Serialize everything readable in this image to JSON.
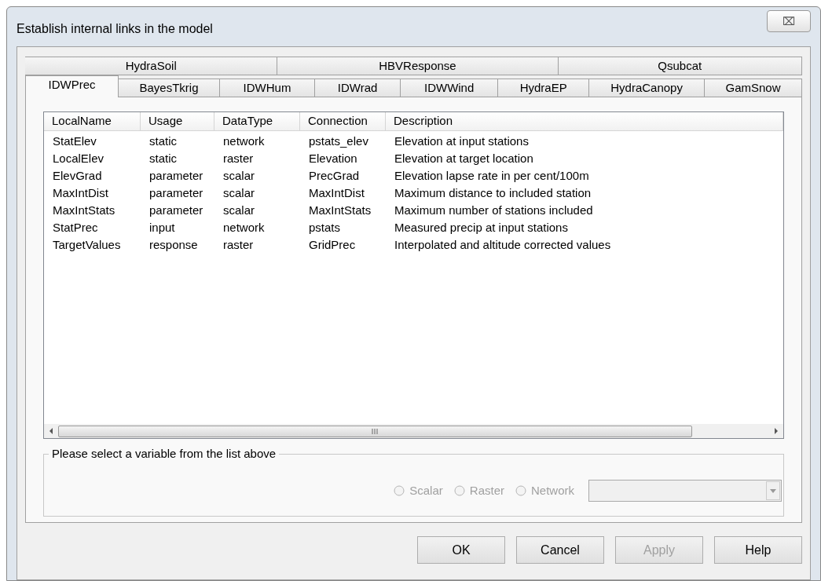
{
  "window": {
    "title": "Establish internal links in the model",
    "close_label": "⌧"
  },
  "tab_rows": [
    [
      {
        "label": "HydraSoil",
        "selected": false
      },
      {
        "label": "HBVResponse",
        "selected": false
      },
      {
        "label": "Qsubcat",
        "selected": false
      }
    ],
    [
      {
        "label": "IDWPrec",
        "selected": true
      },
      {
        "label": "BayesTkrig",
        "selected": false
      },
      {
        "label": "IDWHum",
        "selected": false
      },
      {
        "label": "IDWrad",
        "selected": false
      },
      {
        "label": "IDWWind",
        "selected": false
      },
      {
        "label": "HydraEP",
        "selected": false
      },
      {
        "label": "HydraCanopy",
        "selected": false
      },
      {
        "label": "GamSnow",
        "selected": false
      }
    ]
  ],
  "table": {
    "columns": [
      "LocalName",
      "Usage",
      "DataType",
      "Connection",
      "Description"
    ],
    "rows": [
      [
        "StatElev",
        "static",
        "network",
        "pstats_elev",
        "Elevation at input stations"
      ],
      [
        "LocalElev",
        "static",
        "raster",
        "Elevation",
        "Elevation at target location"
      ],
      [
        "ElevGrad",
        "parameter",
        "scalar",
        "PrecGrad",
        "Elevation lapse rate in per cent/100m"
      ],
      [
        "MaxIntDist",
        "parameter",
        "scalar",
        "MaxIntDist",
        "Maximum distance to included station"
      ],
      [
        "MaxIntStats",
        "parameter",
        "scalar",
        "MaxIntStats",
        "Maximum number of stations included"
      ],
      [
        "StatPrec",
        "input",
        "network",
        "pstats",
        "Measured precip at input stations"
      ],
      [
        "TargetValues",
        "response",
        "raster",
        "GridPrec",
        "Interpolated and altitude corrected values"
      ]
    ]
  },
  "group": {
    "title": "Please select a variable from the list above",
    "radios": [
      {
        "label": "Scalar",
        "selected": false,
        "disabled": true
      },
      {
        "label": "Raster",
        "selected": false,
        "disabled": true
      },
      {
        "label": "Network",
        "selected": false,
        "disabled": true
      }
    ],
    "dropdown": {
      "disabled": true
    }
  },
  "buttons": [
    {
      "label": "OK",
      "disabled": false
    },
    {
      "label": "Cancel",
      "disabled": false
    },
    {
      "label": "Apply",
      "disabled": true
    },
    {
      "label": "Help",
      "disabled": false
    }
  ]
}
